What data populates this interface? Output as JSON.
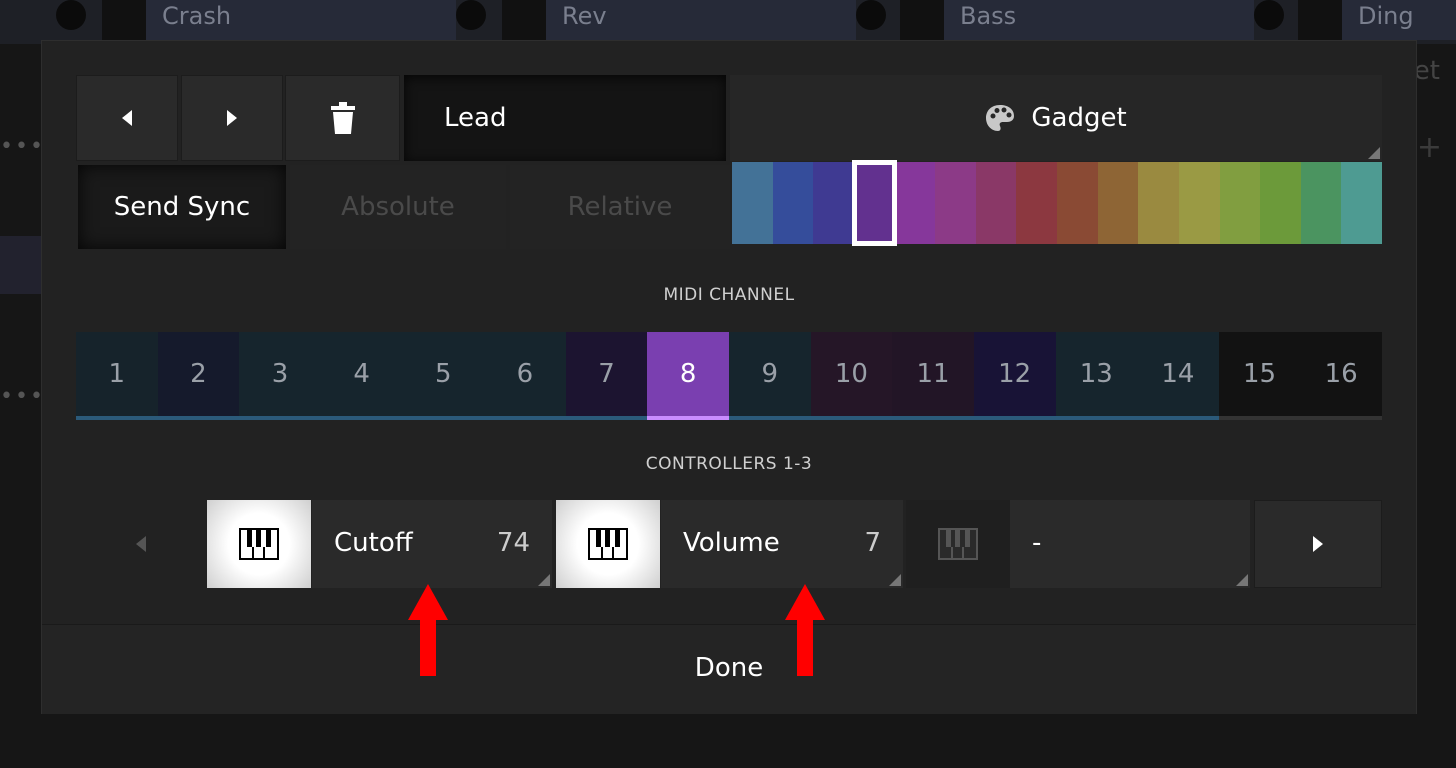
{
  "background": {
    "tracks": [
      "Crash",
      "Rev",
      "Bass",
      "Ding"
    ],
    "right_text": "et",
    "dots": "•••",
    "plus": "+"
  },
  "toolbar": {
    "prev_icon": "triangle-left-icon",
    "next_icon": "triangle-right-icon",
    "delete_icon": "trash-icon",
    "name_value": "Lead",
    "device_icon": "palette-icon",
    "device_label": "Gadget"
  },
  "modes": {
    "send_sync": "Send Sync",
    "absolute": "Absolute",
    "relative": "Relative"
  },
  "palette": {
    "colors": [
      "#437297",
      "#354d9b",
      "#3f3a92",
      "#62318f",
      "#86379b",
      "#8c3a87",
      "#8a3867",
      "#8c3840",
      "#8a4a34",
      "#8e6535",
      "#9a8a40",
      "#9a9a44",
      "#819e40",
      "#6c9a3a",
      "#4b9460",
      "#4e9b92"
    ],
    "selected_index": 3
  },
  "midi": {
    "label": "MIDI CHANNEL",
    "channels": [
      "1",
      "2",
      "3",
      "4",
      "5",
      "6",
      "7",
      "8",
      "9",
      "10",
      "11",
      "12",
      "13",
      "14",
      "15",
      "16"
    ],
    "tints": [
      "#16232b",
      "#151a2c",
      "#16252d",
      "#16252d",
      "#16252d",
      "#16252d",
      "#1c1430",
      "#7a3fb0",
      "#16252d",
      "#251627",
      "#221526",
      "#181336",
      "#16252d",
      "#16252d",
      "#121212",
      "#121212"
    ],
    "selected": "8"
  },
  "controllers": {
    "label": "CONTROLLERS 1-3",
    "items": [
      {
        "name": "Cutoff",
        "number": "74"
      },
      {
        "name": "Volume",
        "number": "7"
      },
      {
        "name": "-",
        "number": ""
      }
    ]
  },
  "done_label": "Done"
}
